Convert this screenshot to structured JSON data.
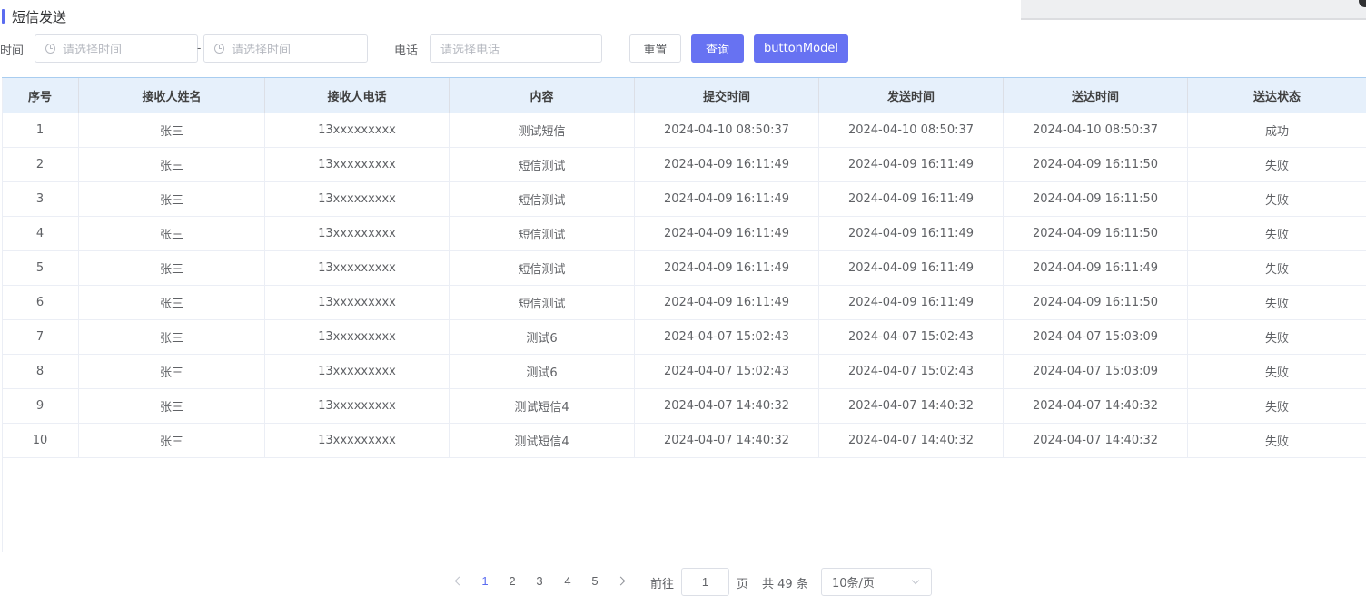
{
  "page": {
    "title": "短信发送"
  },
  "filters": {
    "time_label": "时间",
    "start_placeholder": "请选择时间",
    "range_separator": "-",
    "end_placeholder": "请选择时间",
    "phone_label": "电话",
    "phone_placeholder": "请选择电话",
    "reset_label": "重置",
    "query_label": "查询",
    "model_label": "buttonModel"
  },
  "colors": {
    "accent": "#6772f2",
    "header_bg": "#e6f0fb",
    "active_page": "#5b6cf0"
  },
  "table": {
    "columns": [
      "序号",
      "接收人姓名",
      "接收人电话",
      "内容",
      "提交时间",
      "发送时间",
      "送达时间",
      "送达状态"
    ],
    "rows": [
      [
        "1",
        "张三",
        "13xxxxxxxxx",
        "测试短信",
        "2024-04-10 08:50:37",
        "2024-04-10 08:50:37",
        "2024-04-10 08:50:37",
        "成功"
      ],
      [
        "2",
        "张三",
        "13xxxxxxxxx",
        "短信测试",
        "2024-04-09 16:11:49",
        "2024-04-09 16:11:49",
        "2024-04-09 16:11:50",
        "失败"
      ],
      [
        "3",
        "张三",
        "13xxxxxxxxx",
        "短信测试",
        "2024-04-09 16:11:49",
        "2024-04-09 16:11:49",
        "2024-04-09 16:11:50",
        "失败"
      ],
      [
        "4",
        "张三",
        "13xxxxxxxxx",
        "短信测试",
        "2024-04-09 16:11:49",
        "2024-04-09 16:11:49",
        "2024-04-09 16:11:50",
        "失败"
      ],
      [
        "5",
        "张三",
        "13xxxxxxxxx",
        "短信测试",
        "2024-04-09 16:11:49",
        "2024-04-09 16:11:49",
        "2024-04-09 16:11:49",
        "失败"
      ],
      [
        "6",
        "张三",
        "13xxxxxxxxx",
        "短信测试",
        "2024-04-09 16:11:49",
        "2024-04-09 16:11:49",
        "2024-04-09 16:11:50",
        "失败"
      ],
      [
        "7",
        "张三",
        "13xxxxxxxxx",
        "测试6",
        "2024-04-07 15:02:43",
        "2024-04-07 15:02:43",
        "2024-04-07 15:03:09",
        "失败"
      ],
      [
        "8",
        "张三",
        "13xxxxxxxxx",
        "测试6",
        "2024-04-07 15:02:43",
        "2024-04-07 15:02:43",
        "2024-04-07 15:03:09",
        "失败"
      ],
      [
        "9",
        "张三",
        "13xxxxxxxxx",
        "测试短信4",
        "2024-04-07 14:40:32",
        "2024-04-07 14:40:32",
        "2024-04-07 14:40:32",
        "失败"
      ],
      [
        "10",
        "张三",
        "13xxxxxxxxx",
        "测试短信4",
        "2024-04-07 14:40:32",
        "2024-04-07 14:40:32",
        "2024-04-07 14:40:32",
        "失败"
      ]
    ]
  },
  "pagination": {
    "pages": [
      "1",
      "2",
      "3",
      "4",
      "5"
    ],
    "current": "1",
    "goto_label": "前往",
    "goto_value": "1",
    "page_unit": "页",
    "total_text": "共 49 条",
    "page_size": "10条/页"
  }
}
